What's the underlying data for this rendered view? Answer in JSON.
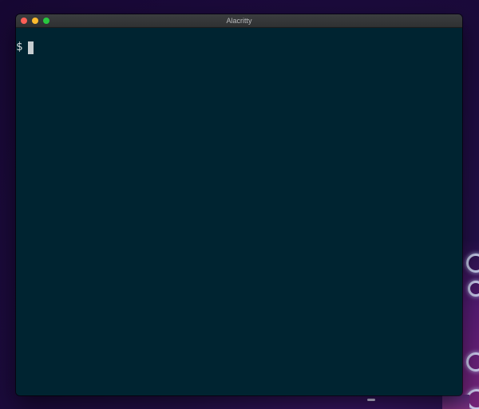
{
  "window": {
    "title": "Alacritty"
  },
  "terminal": {
    "prompt": "$"
  }
}
